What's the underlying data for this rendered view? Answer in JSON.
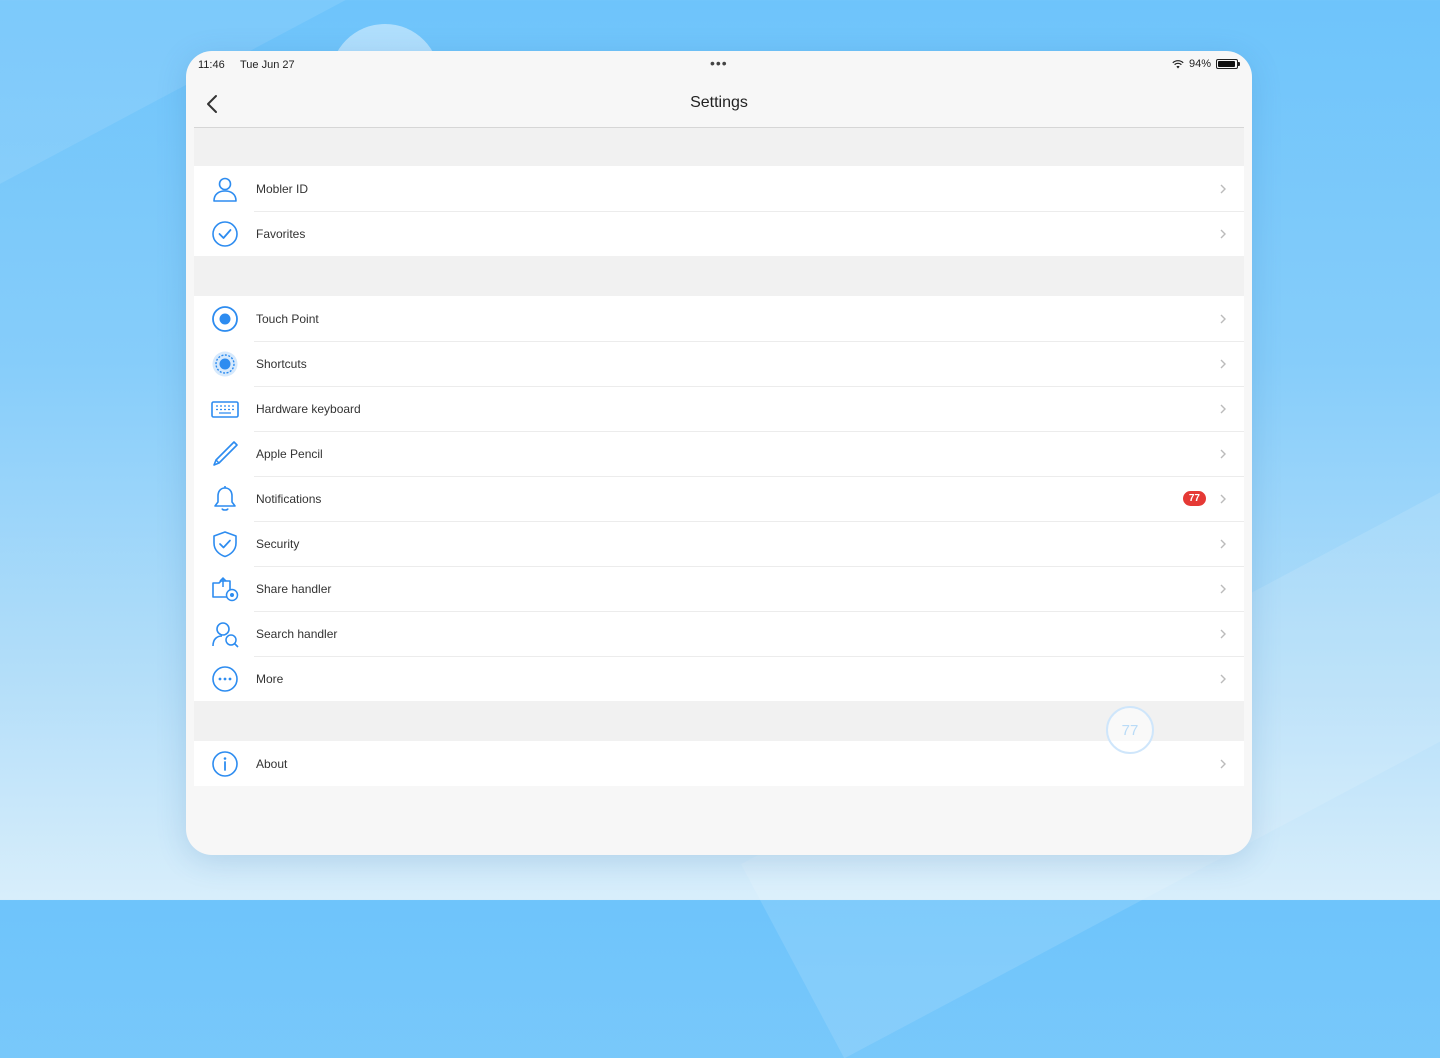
{
  "status_bar": {
    "time": "11:46",
    "date": "Tue Jun 27",
    "multitask_dots": "•••",
    "battery": "94%"
  },
  "nav": {
    "title": "Settings"
  },
  "groups": [
    {
      "items": [
        {
          "label": "Mobler ID",
          "icon": "person-icon"
        },
        {
          "label": "Favorites",
          "icon": "checkmark-circle-icon"
        }
      ]
    },
    {
      "items": [
        {
          "label": "Touch Point",
          "icon": "touch-point-icon"
        },
        {
          "label": "Shortcuts",
          "icon": "shortcuts-icon"
        },
        {
          "label": "Hardware keyboard",
          "icon": "keyboard-icon"
        },
        {
          "label": "Apple Pencil",
          "icon": "pencil-icon"
        },
        {
          "label": "Notifications",
          "icon": "bell-icon",
          "badge": "77"
        },
        {
          "label": "Security",
          "icon": "shield-check-icon"
        },
        {
          "label": "Share handler",
          "icon": "share-handler-icon"
        },
        {
          "label": "Search handler",
          "icon": "search-person-icon"
        },
        {
          "label": "More",
          "icon": "ellipsis-circle-icon"
        }
      ]
    },
    {
      "items": [
        {
          "label": "About",
          "icon": "info-circle-icon"
        }
      ]
    }
  ],
  "floating_button": {
    "label": "77"
  },
  "colors": {
    "accent": "#2d8cf0",
    "badge": "#e53935",
    "background": "#7ec8fa"
  }
}
